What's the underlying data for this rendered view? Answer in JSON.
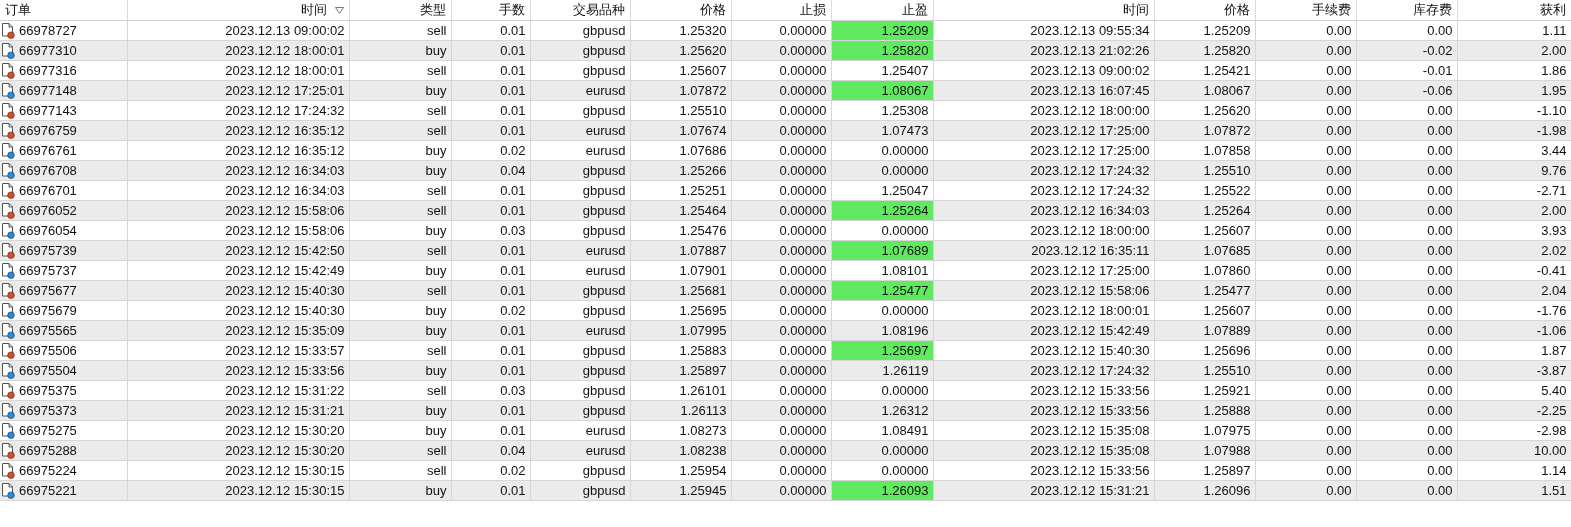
{
  "table": {
    "columns": [
      {
        "label": "订单",
        "sorted": false
      },
      {
        "label": "时间",
        "sorted": true
      },
      {
        "label": "类型",
        "sorted": false
      },
      {
        "label": "手数",
        "sorted": false
      },
      {
        "label": "交易品种",
        "sorted": false
      },
      {
        "label": "价格",
        "sorted": false
      },
      {
        "label": "止损",
        "sorted": false
      },
      {
        "label": "止盈",
        "sorted": false
      },
      {
        "label": "时间",
        "sorted": false
      },
      {
        "label": "价格",
        "sorted": false
      },
      {
        "label": "手续费",
        "sorted": false
      },
      {
        "label": "库存费",
        "sorted": false
      },
      {
        "label": "获利",
        "sorted": false
      }
    ],
    "rows": [
      {
        "kind": "sell",
        "tp_hit": true,
        "cells": [
          "66978727",
          "2023.12.13 09:00:02",
          "sell",
          "0.01",
          "gbpusd",
          "1.25320",
          "0.00000",
          "1.25209",
          "2023.12.13 09:55:34",
          "1.25209",
          "0.00",
          "0.00",
          "1.11"
        ]
      },
      {
        "kind": "buy",
        "tp_hit": true,
        "cells": [
          "66977310",
          "2023.12.12 18:00:01",
          "buy",
          "0.01",
          "gbpusd",
          "1.25620",
          "0.00000",
          "1.25820",
          "2023.12.13 21:02:26",
          "1.25820",
          "0.00",
          "-0.02",
          "2.00"
        ]
      },
      {
        "kind": "sell",
        "tp_hit": false,
        "cells": [
          "66977316",
          "2023.12.12 18:00:01",
          "sell",
          "0.01",
          "gbpusd",
          "1.25607",
          "0.00000",
          "1.25407",
          "2023.12.13 09:00:02",
          "1.25421",
          "0.00",
          "-0.01",
          "1.86"
        ]
      },
      {
        "kind": "buy",
        "tp_hit": true,
        "cells": [
          "66977148",
          "2023.12.12 17:25:01",
          "buy",
          "0.01",
          "eurusd",
          "1.07872",
          "0.00000",
          "1.08067",
          "2023.12.13 16:07:45",
          "1.08067",
          "0.00",
          "-0.06",
          "1.95"
        ]
      },
      {
        "kind": "sell",
        "tp_hit": false,
        "cells": [
          "66977143",
          "2023.12.12 17:24:32",
          "sell",
          "0.01",
          "gbpusd",
          "1.25510",
          "0.00000",
          "1.25308",
          "2023.12.12 18:00:00",
          "1.25620",
          "0.00",
          "0.00",
          "-1.10"
        ]
      },
      {
        "kind": "sell",
        "tp_hit": false,
        "cells": [
          "66976759",
          "2023.12.12 16:35:12",
          "sell",
          "0.01",
          "eurusd",
          "1.07674",
          "0.00000",
          "1.07473",
          "2023.12.12 17:25:00",
          "1.07872",
          "0.00",
          "0.00",
          "-1.98"
        ]
      },
      {
        "kind": "buy",
        "tp_hit": false,
        "cells": [
          "66976761",
          "2023.12.12 16:35:12",
          "buy",
          "0.02",
          "eurusd",
          "1.07686",
          "0.00000",
          "0.00000",
          "2023.12.12 17:25:00",
          "1.07858",
          "0.00",
          "0.00",
          "3.44"
        ]
      },
      {
        "kind": "buy",
        "tp_hit": false,
        "cells": [
          "66976708",
          "2023.12.12 16:34:03",
          "buy",
          "0.04",
          "gbpusd",
          "1.25266",
          "0.00000",
          "0.00000",
          "2023.12.12 17:24:32",
          "1.25510",
          "0.00",
          "0.00",
          "9.76"
        ]
      },
      {
        "kind": "sell",
        "tp_hit": false,
        "cells": [
          "66976701",
          "2023.12.12 16:34:03",
          "sell",
          "0.01",
          "gbpusd",
          "1.25251",
          "0.00000",
          "1.25047",
          "2023.12.12 17:24:32",
          "1.25522",
          "0.00",
          "0.00",
          "-2.71"
        ]
      },
      {
        "kind": "sell",
        "tp_hit": true,
        "cells": [
          "66976052",
          "2023.12.12 15:58:06",
          "sell",
          "0.01",
          "gbpusd",
          "1.25464",
          "0.00000",
          "1.25264",
          "2023.12.12 16:34:03",
          "1.25264",
          "0.00",
          "0.00",
          "2.00"
        ]
      },
      {
        "kind": "buy",
        "tp_hit": false,
        "cells": [
          "66976054",
          "2023.12.12 15:58:06",
          "buy",
          "0.03",
          "gbpusd",
          "1.25476",
          "0.00000",
          "0.00000",
          "2023.12.12 18:00:00",
          "1.25607",
          "0.00",
          "0.00",
          "3.93"
        ]
      },
      {
        "kind": "sell",
        "tp_hit": true,
        "cells": [
          "66975739",
          "2023.12.12 15:42:50",
          "sell",
          "0.01",
          "eurusd",
          "1.07887",
          "0.00000",
          "1.07689",
          "2023.12.12 16:35:11",
          "1.07685",
          "0.00",
          "0.00",
          "2.02"
        ]
      },
      {
        "kind": "buy",
        "tp_hit": false,
        "cells": [
          "66975737",
          "2023.12.12 15:42:49",
          "buy",
          "0.01",
          "eurusd",
          "1.07901",
          "0.00000",
          "1.08101",
          "2023.12.12 17:25:00",
          "1.07860",
          "0.00",
          "0.00",
          "-0.41"
        ]
      },
      {
        "kind": "sell",
        "tp_hit": true,
        "cells": [
          "66975677",
          "2023.12.12 15:40:30",
          "sell",
          "0.01",
          "gbpusd",
          "1.25681",
          "0.00000",
          "1.25477",
          "2023.12.12 15:58:06",
          "1.25477",
          "0.00",
          "0.00",
          "2.04"
        ]
      },
      {
        "kind": "buy",
        "tp_hit": false,
        "cells": [
          "66975679",
          "2023.12.12 15:40:30",
          "buy",
          "0.02",
          "gbpusd",
          "1.25695",
          "0.00000",
          "0.00000",
          "2023.12.12 18:00:01",
          "1.25607",
          "0.00",
          "0.00",
          "-1.76"
        ]
      },
      {
        "kind": "buy",
        "tp_hit": false,
        "cells": [
          "66975565",
          "2023.12.12 15:35:09",
          "buy",
          "0.01",
          "eurusd",
          "1.07995",
          "0.00000",
          "1.08196",
          "2023.12.12 15:42:49",
          "1.07889",
          "0.00",
          "0.00",
          "-1.06"
        ]
      },
      {
        "kind": "sell",
        "tp_hit": true,
        "cells": [
          "66975506",
          "2023.12.12 15:33:57",
          "sell",
          "0.01",
          "gbpusd",
          "1.25883",
          "0.00000",
          "1.25697",
          "2023.12.12 15:40:30",
          "1.25696",
          "0.00",
          "0.00",
          "1.87"
        ]
      },
      {
        "kind": "buy",
        "tp_hit": false,
        "cells": [
          "66975504",
          "2023.12.12 15:33:56",
          "buy",
          "0.01",
          "gbpusd",
          "1.25897",
          "0.00000",
          "1.26119",
          "2023.12.12 17:24:32",
          "1.25510",
          "0.00",
          "0.00",
          "-3.87"
        ]
      },
      {
        "kind": "sell",
        "tp_hit": false,
        "cells": [
          "66975375",
          "2023.12.12 15:31:22",
          "sell",
          "0.03",
          "gbpusd",
          "1.26101",
          "0.00000",
          "0.00000",
          "2023.12.12 15:33:56",
          "1.25921",
          "0.00",
          "0.00",
          "5.40"
        ]
      },
      {
        "kind": "buy",
        "tp_hit": false,
        "cells": [
          "66975373",
          "2023.12.12 15:31:21",
          "buy",
          "0.01",
          "gbpusd",
          "1.26113",
          "0.00000",
          "1.26312",
          "2023.12.12 15:33:56",
          "1.25888",
          "0.00",
          "0.00",
          "-2.25"
        ]
      },
      {
        "kind": "buy",
        "tp_hit": false,
        "cells": [
          "66975275",
          "2023.12.12 15:30:20",
          "buy",
          "0.01",
          "eurusd",
          "1.08273",
          "0.00000",
          "1.08491",
          "2023.12.12 15:35:08",
          "1.07975",
          "0.00",
          "0.00",
          "-2.98"
        ]
      },
      {
        "kind": "sell",
        "tp_hit": false,
        "cells": [
          "66975288",
          "2023.12.12 15:30:20",
          "sell",
          "0.04",
          "eurusd",
          "1.08238",
          "0.00000",
          "0.00000",
          "2023.12.12 15:35:08",
          "1.07988",
          "0.00",
          "0.00",
          "10.00"
        ]
      },
      {
        "kind": "sell",
        "tp_hit": false,
        "cells": [
          "66975224",
          "2023.12.12 15:30:15",
          "sell",
          "0.02",
          "gbpusd",
          "1.25954",
          "0.00000",
          "0.00000",
          "2023.12.12 15:33:56",
          "1.25897",
          "0.00",
          "0.00",
          "1.14"
        ]
      },
      {
        "kind": "buy",
        "tp_hit": true,
        "cells": [
          "66975221",
          "2023.12.12 15:30:15",
          "buy",
          "0.01",
          "gbpusd",
          "1.25945",
          "0.00000",
          "1.26093",
          "2023.12.12 15:31:21",
          "1.26096",
          "0.00",
          "0.00",
          "1.51"
        ]
      }
    ]
  }
}
